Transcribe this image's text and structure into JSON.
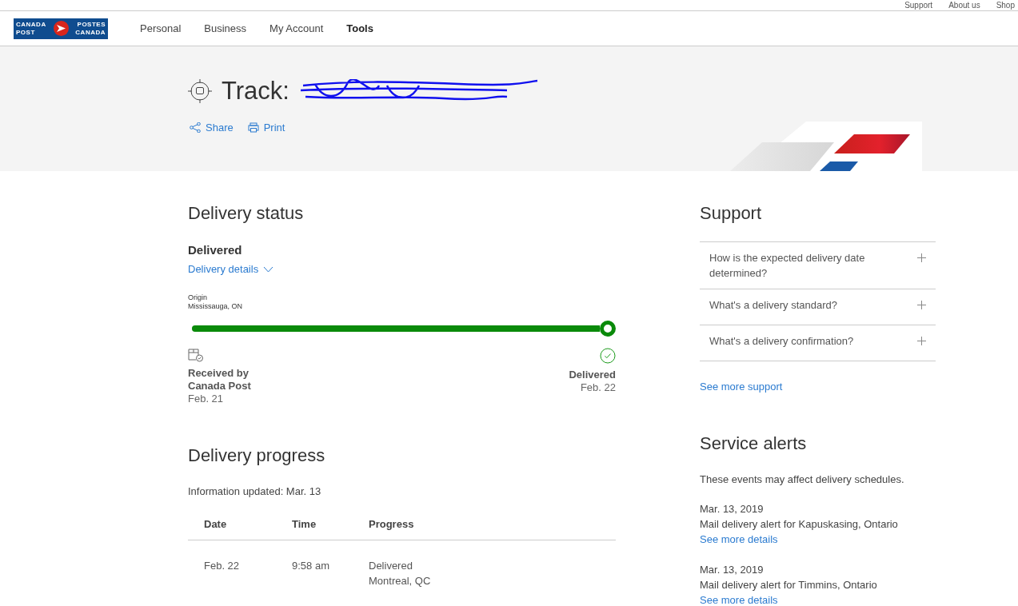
{
  "utility_links": [
    "Support",
    "About us",
    "Shop"
  ],
  "logo": {
    "top_left": "CANADA",
    "bottom_left": "POST",
    "top_right": "POSTES",
    "bottom_right": "CANADA"
  },
  "nav": [
    {
      "label": "Personal",
      "selected": false
    },
    {
      "label": "Business",
      "selected": false
    },
    {
      "label": "My Account",
      "selected": false
    },
    {
      "label": "Tools",
      "selected": true
    }
  ],
  "header": {
    "title": "Track:",
    "actions": [
      {
        "kind": "share",
        "label": "Share"
      },
      {
        "kind": "print",
        "label": "Print"
      }
    ]
  },
  "delivery_status": {
    "heading": "Delivery status",
    "status": "Delivered",
    "details_link": "Delivery details",
    "origin_label": "Origin",
    "origin": "Mississauga, ON",
    "level": 1,
    "start": {
      "title": "Received by Canada Post",
      "date": "Feb. 21"
    },
    "end": {
      "title": "Delivered",
      "date": "Feb. 22"
    }
  },
  "delivery_progress": {
    "heading": "Delivery progress",
    "updated": "Information updated: Mar. 13",
    "columns": [
      "Date",
      "Time",
      "Progress"
    ],
    "rows": [
      {
        "date": "Feb. 22",
        "time": "9:58 am",
        "progress": [
          "Delivered",
          "Montreal, QC"
        ]
      }
    ]
  },
  "support": {
    "heading": "Support",
    "items": [
      {
        "question": "How is the expected delivery date determined?",
        "expanded": false
      },
      {
        "question": "What's a delivery standard?",
        "expanded": false
      },
      {
        "question": "What's a delivery confirmation?",
        "expanded": false
      }
    ],
    "more": "See more support"
  },
  "service_alerts": {
    "heading": "Service alerts",
    "intro": "These events may affect delivery schedules.",
    "alerts": [
      {
        "date": "Mar. 13, 2019",
        "text": "Mail delivery alert for Kapuskasing, Ontario",
        "link": "See more details"
      },
      {
        "date": "Mar. 13, 2019",
        "text": "Mail delivery alert for Timmins, Ontario",
        "link": "See more details"
      }
    ]
  }
}
